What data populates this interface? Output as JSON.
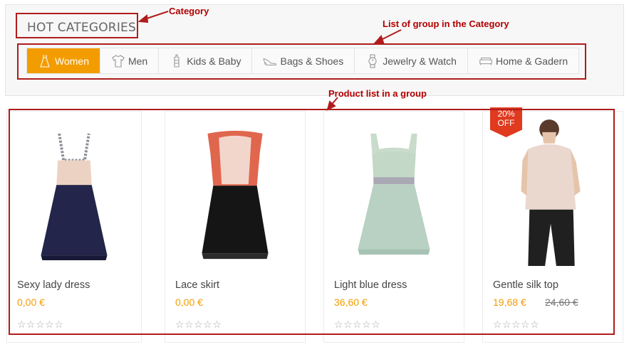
{
  "annotations": {
    "category": "Category",
    "group_list": "List of group in the Category",
    "product_list": "Product list in a group"
  },
  "category": {
    "title": "HOT CATEGORIES"
  },
  "tabs": [
    {
      "label": "Women",
      "icon": "dress-icon",
      "active": true
    },
    {
      "label": "Men",
      "icon": "tshirt-icon"
    },
    {
      "label": "Kids & Baby",
      "icon": "baby-bottle-icon"
    },
    {
      "label": "Bags & Shoes",
      "icon": "high-heel-icon"
    },
    {
      "label": "Jewelry & Watch",
      "icon": "watch-icon"
    },
    {
      "label": "Home & Gadern",
      "icon": "sofa-icon"
    }
  ],
  "products": [
    {
      "name": "Sexy lady dress",
      "price": "0,00 €",
      "rating": "☆☆☆☆☆"
    },
    {
      "name": "Lace skirt",
      "price": "0,00 €",
      "rating": "☆☆☆☆☆"
    },
    {
      "name": "Light blue dress",
      "price": "36,60 €",
      "rating": "☆☆☆☆☆"
    },
    {
      "name": "Gentle silk top",
      "price": "19,68 €",
      "old_price": "24,60 €",
      "rating": "☆☆☆☆☆",
      "badge_line1": "20%",
      "badge_line2": "OFF"
    }
  ],
  "colors": {
    "accent": "#f39c00",
    "annotation": "#b01c1c",
    "badge": "#e03a1f"
  }
}
